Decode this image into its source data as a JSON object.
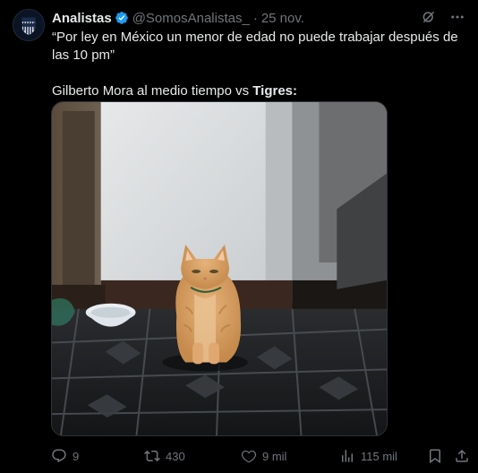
{
  "author": {
    "display_name": "Analistas",
    "handle": "@SomosAnalistas_",
    "separator": "·",
    "date": "25 nov.",
    "verified": true,
    "avatar_icon": "club-crest-icon"
  },
  "tweet": {
    "line1": "“Por ley en México un menor de edad no puede trabajar después de las 10 pm”",
    "line2_prefix": "Gilberto Mora al medio tiempo vs ",
    "line2_bold": "Tigres:",
    "media_icon": "cat-photo"
  },
  "header_actions": [
    "grok-icon",
    "more-icon"
  ],
  "metrics": {
    "replies": "9",
    "reposts": "430",
    "likes": "9 mil",
    "views": "115 mil"
  },
  "colors": {
    "background": "#000000",
    "text": "#e7e9ea",
    "muted": "#71767b",
    "verified": "#1d9bf0"
  }
}
